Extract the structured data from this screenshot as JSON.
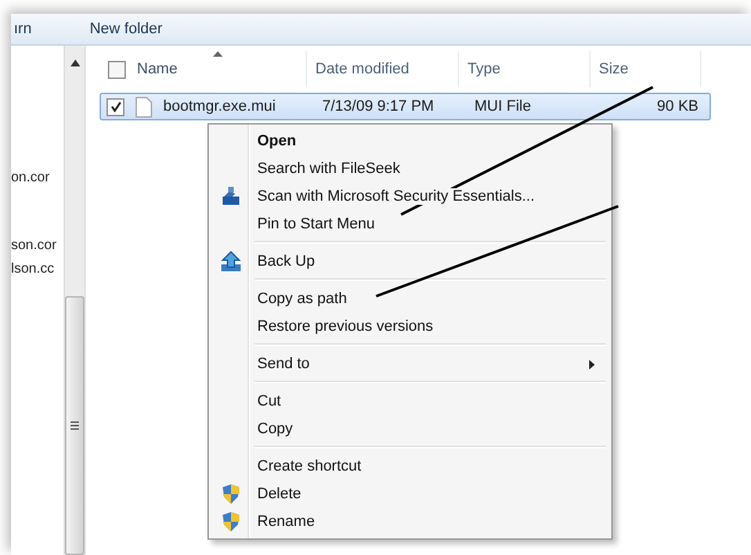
{
  "toolbar": {
    "items": [
      "ırn",
      "New folder"
    ]
  },
  "nav_pane": {
    "items": [
      "on.cor",
      "son.cor",
      "lson.cc"
    ]
  },
  "file_list": {
    "select_all_checked": false,
    "columns": [
      {
        "label": "Name",
        "sorted": true
      },
      {
        "label": "Date modified",
        "sorted": false
      },
      {
        "label": "Type",
        "sorted": false
      },
      {
        "label": "Size",
        "sorted": false
      }
    ],
    "rows": [
      {
        "name": "bootmgr.exe.mui",
        "date": "7/13/09 9:17 PM",
        "type": "MUI File",
        "size": "90 KB",
        "checked": true,
        "selected": true
      }
    ]
  },
  "context_menu": {
    "groups": [
      [
        {
          "label": "Open",
          "default": true,
          "submenu": false,
          "kind": "plain"
        },
        {
          "label": "Search with FileSeek",
          "default": false,
          "submenu": false,
          "kind": "plain"
        },
        {
          "label": "Scan with Microsoft Security Essentials...",
          "default": false,
          "submenu": false,
          "kind": "scan"
        },
        {
          "label": "Pin to Start Menu",
          "default": false,
          "submenu": false,
          "kind": "plain"
        }
      ],
      [
        {
          "label": "Back Up",
          "default": false,
          "submenu": false,
          "kind": "backup"
        }
      ],
      [
        {
          "label": "Copy as path",
          "default": false,
          "submenu": false,
          "kind": "plain"
        },
        {
          "label": "Restore previous versions",
          "default": false,
          "submenu": false,
          "kind": "plain"
        }
      ],
      [
        {
          "label": "Send to",
          "default": false,
          "submenu": true,
          "kind": "plain"
        }
      ],
      [
        {
          "label": "Cut",
          "default": false,
          "submenu": false,
          "kind": "plain"
        },
        {
          "label": "Copy",
          "default": false,
          "submenu": false,
          "kind": "plain"
        }
      ],
      [
        {
          "label": "Create shortcut",
          "default": false,
          "submenu": false,
          "kind": "plain"
        },
        {
          "label": "Delete",
          "default": false,
          "submenu": false,
          "kind": "secure"
        },
        {
          "label": "Rename",
          "default": false,
          "submenu": false,
          "kind": "secure"
        }
      ]
    ]
  }
}
